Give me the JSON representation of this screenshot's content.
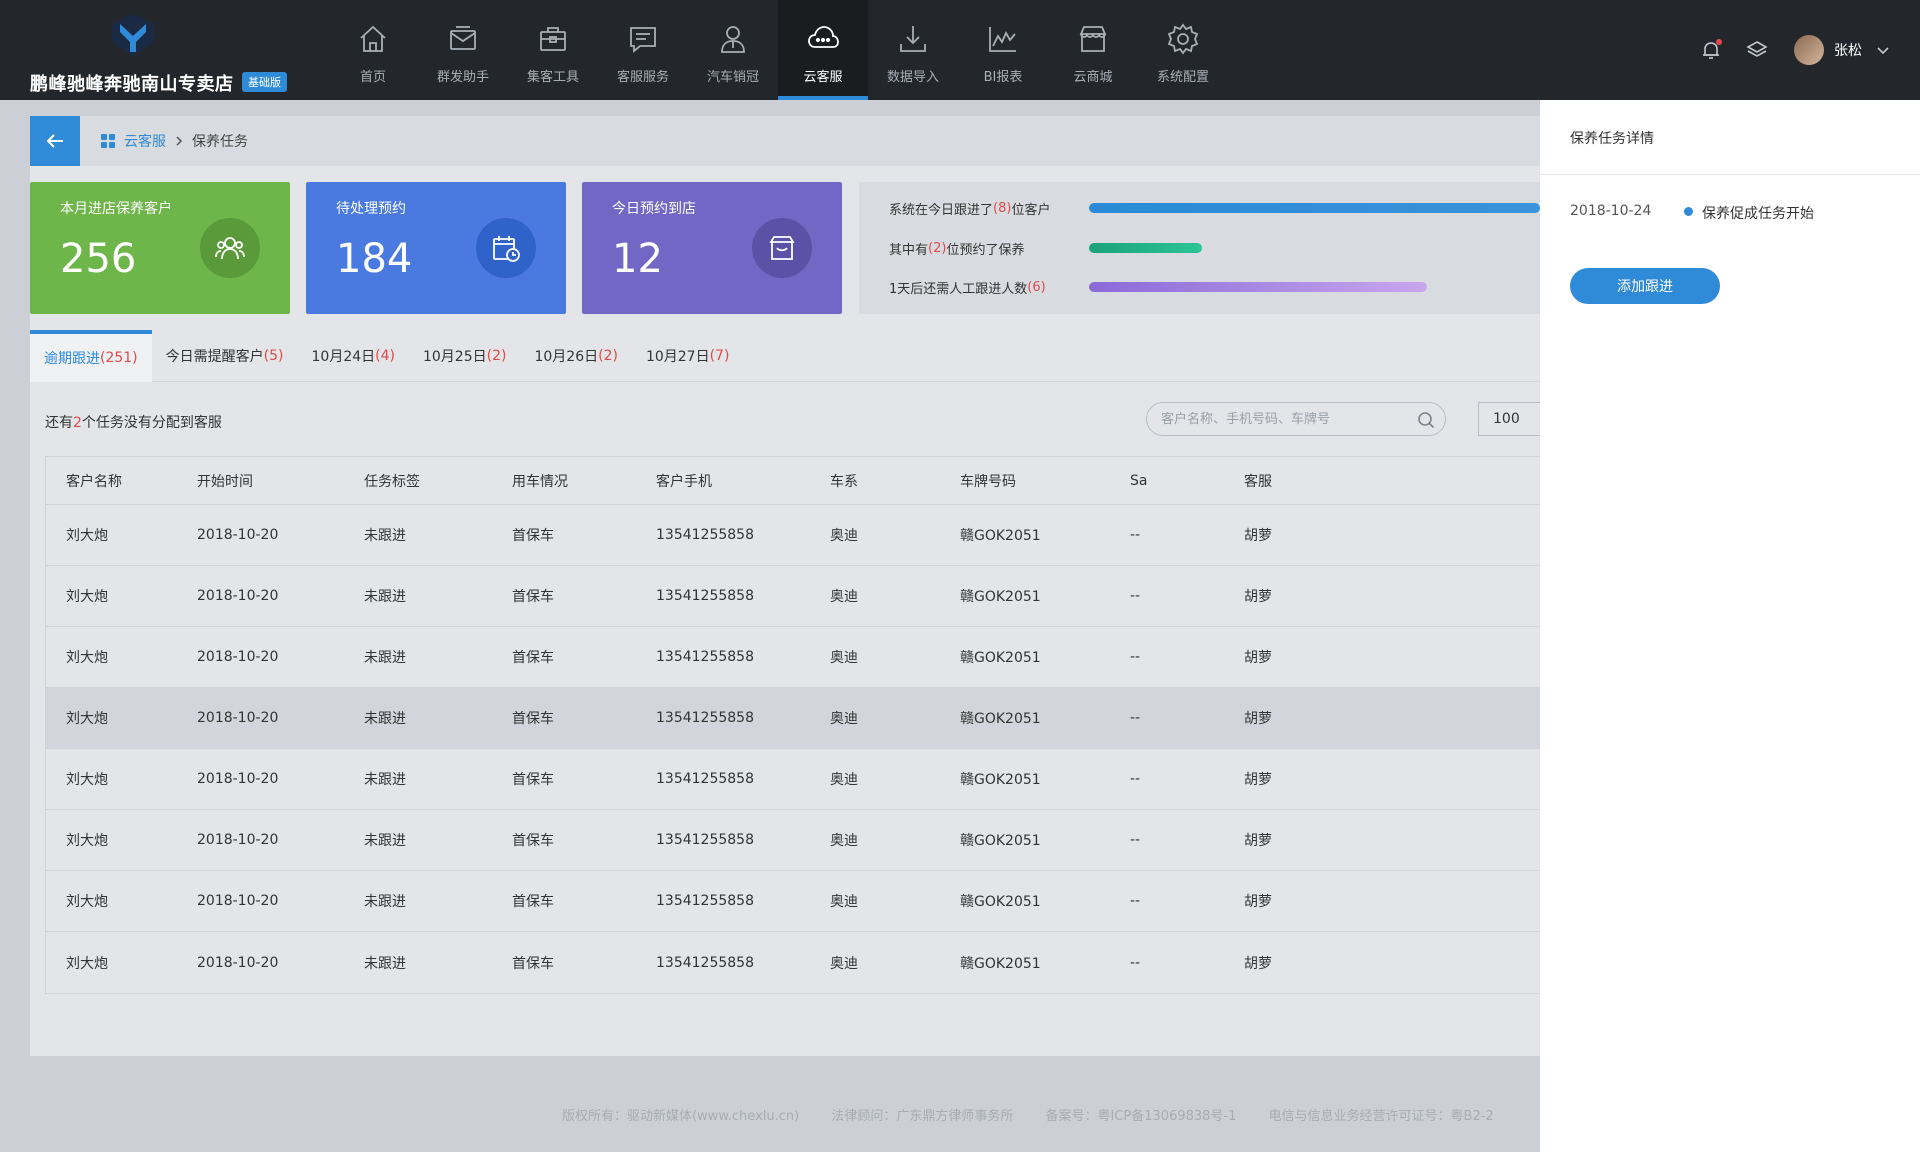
{
  "brand": {
    "name": "鹏峰驰峰奔驰南山专卖店",
    "badge": "基础版"
  },
  "nav": [
    {
      "label": "首页",
      "icon": "home-icon"
    },
    {
      "label": "群发助手",
      "icon": "mail-icon"
    },
    {
      "label": "集客工具",
      "icon": "toolbox-icon"
    },
    {
      "label": "客服服务",
      "icon": "message-icon"
    },
    {
      "label": "汽车销冠",
      "icon": "person-icon"
    },
    {
      "label": "云客服",
      "icon": "cloud-chat-icon",
      "active": true
    },
    {
      "label": "数据导入",
      "icon": "download-icon"
    },
    {
      "label": "BI报表",
      "icon": "chart-icon"
    },
    {
      "label": "云商城",
      "icon": "store-icon"
    },
    {
      "label": "系统配置",
      "icon": "gear-icon"
    }
  ],
  "user": {
    "name": "张松"
  },
  "breadcrumb": {
    "home": "云客服",
    "current": "保养任务"
  },
  "stats": [
    {
      "label": "本月进店保养客户",
      "value": "256",
      "color": "#6eb54a",
      "circle": "#5a9a3b"
    },
    {
      "label": "待处理预约",
      "value": "184",
      "color": "#4a7ae0",
      "circle": "#2f63c9"
    },
    {
      "label": "今日预约到店",
      "value": "12",
      "color": "#7267c4",
      "circle": "#5b52a8"
    }
  ],
  "progress": {
    "row1": {
      "pre": "系统在今日跟进了",
      "count": "(8)",
      "post": "位客户",
      "fraction": 1.0
    },
    "row2": {
      "pre": "其中有",
      "count": "(2)",
      "post": "位预约了保养",
      "fraction": 0.25
    },
    "row3": {
      "pre": "1天后还需人工跟进人数",
      "count": "(6)",
      "post": "",
      "fraction": 0.75
    }
  },
  "tabs": [
    {
      "label": "逾期跟进",
      "count": "(251)",
      "active": true
    },
    {
      "label": "今日需提醒客户",
      "count": "(5)"
    },
    {
      "label": "10月24日",
      "count": "(4)"
    },
    {
      "label": "10月25日",
      "count": "(2)"
    },
    {
      "label": "10月26日",
      "count": "(2)"
    },
    {
      "label": "10月27日",
      "count": "(7)"
    }
  ],
  "notice": {
    "pre": "还有",
    "count": "2",
    "post": "个任务没有分配到客服"
  },
  "search": {
    "placeholder": "客户名称、手机号码、车牌号"
  },
  "page_size": "100",
  "table": {
    "headers": [
      "客户名称",
      "开始时间",
      "任务标签",
      "用车情况",
      "客户手机",
      "车系",
      "车牌号码",
      "Sa",
      "客服"
    ],
    "rows": [
      [
        "刘大炮",
        "2018-10-20",
        "未跟进",
        "首保车",
        "13541255858",
        "奥迪",
        "赣GOK2051",
        "--",
        "胡萝"
      ],
      [
        "刘大炮",
        "2018-10-20",
        "未跟进",
        "首保车",
        "13541255858",
        "奥迪",
        "赣GOK2051",
        "--",
        "胡萝"
      ],
      [
        "刘大炮",
        "2018-10-20",
        "未跟进",
        "首保车",
        "13541255858",
        "奥迪",
        "赣GOK2051",
        "--",
        "胡萝"
      ],
      [
        "刘大炮",
        "2018-10-20",
        "未跟进",
        "首保车",
        "13541255858",
        "奥迪",
        "赣GOK2051",
        "--",
        "胡萝"
      ],
      [
        "刘大炮",
        "2018-10-20",
        "未跟进",
        "首保车",
        "13541255858",
        "奥迪",
        "赣GOK2051",
        "--",
        "胡萝"
      ],
      [
        "刘大炮",
        "2018-10-20",
        "未跟进",
        "首保车",
        "13541255858",
        "奥迪",
        "赣GOK2051",
        "--",
        "胡萝"
      ],
      [
        "刘大炮",
        "2018-10-20",
        "未跟进",
        "首保车",
        "13541255858",
        "奥迪",
        "赣GOK2051",
        "--",
        "胡萝"
      ],
      [
        "刘大炮",
        "2018-10-20",
        "未跟进",
        "首保车",
        "13541255858",
        "奥迪",
        "赣GOK2051",
        "--",
        "胡萝"
      ]
    ]
  },
  "footer": {
    "copyright": "版权所有：驱动新媒体(www.chexlu.cn)",
    "legal": "法律顾问：广东鼎方律师事务所",
    "icp": "备案号：粤ICP备13069838号-1",
    "license": "电信与信息业务经营许可证号：粤B2-2"
  },
  "panel": {
    "title": "保养任务详情",
    "date": "2018-10-24",
    "event": "保养促成任务开始",
    "button": "添加跟进"
  }
}
